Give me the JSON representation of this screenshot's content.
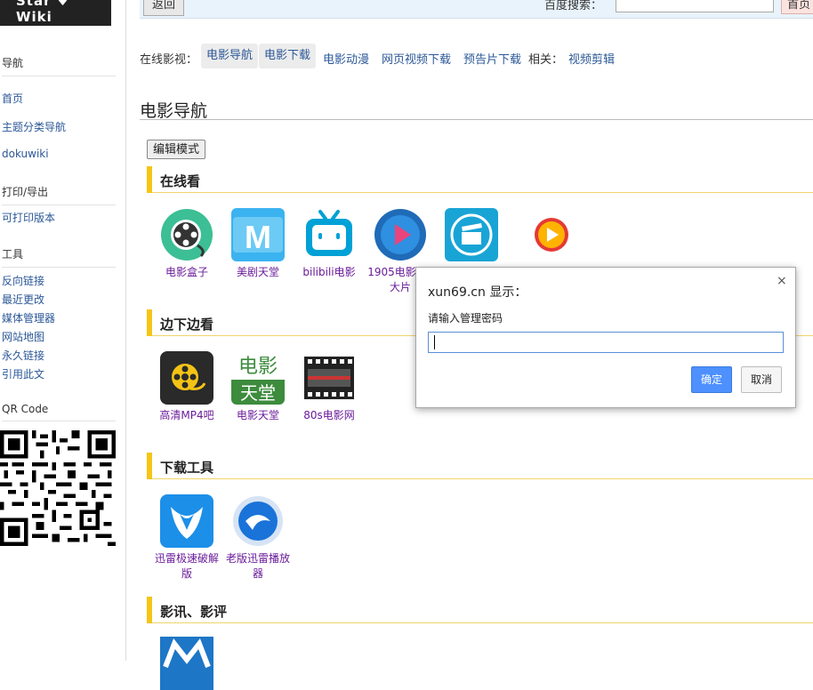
{
  "logo": {
    "text": "Star ♥ Wiki"
  },
  "sidebar": {
    "sections": [
      {
        "heading": "导航",
        "links": [
          "首页",
          "主题分类导航",
          "dokuwiki"
        ]
      },
      {
        "heading": "打印/导出",
        "links": [
          "可打印版本"
        ]
      },
      {
        "heading": "工具",
        "links": [
          "反向链接",
          "最近更改",
          "媒体管理器",
          "网站地图",
          "永久链接",
          "引用此文"
        ]
      },
      {
        "heading": "QR Code",
        "links": []
      }
    ]
  },
  "topbar": {
    "back_label": "返回",
    "search_label": "百度搜索：",
    "search_value": "",
    "home_label": "首页"
  },
  "nav": {
    "prefix": "在线影视：",
    "items": [
      "电影导航",
      "电影下载",
      "电影动漫",
      "网页视频下载",
      "预告片下载"
    ],
    "related_label": "相关：",
    "related_item": "视频剪辑"
  },
  "page": {
    "title": "电影导航",
    "edit_button": "编辑模式"
  },
  "sections": [
    {
      "heading": "在线看",
      "tiles": [
        {
          "caption": "电影盒子",
          "icon": "film-reel-icon"
        },
        {
          "caption": "美剧天堂",
          "icon": "meiju-icon"
        },
        {
          "caption": "bilibili电影",
          "icon": "bilibili-tv-icon"
        },
        {
          "caption": "1905电影网•大片",
          "icon": "play-circle-icon"
        },
        {
          "caption": "",
          "icon": "clapperboard-icon"
        },
        {
          "caption": "",
          "icon": "orange-play-icon"
        }
      ]
    },
    {
      "heading": "边下边看",
      "tiles": [
        {
          "caption": "高清MP4吧",
          "icon": "film-reel-dark-icon"
        },
        {
          "caption": "电影天堂",
          "icon": "dianying-tiantang-icon"
        },
        {
          "caption": "80s电影网",
          "icon": "film-strip-icon"
        }
      ]
    },
    {
      "heading": "下载工具",
      "tiles": [
        {
          "caption": "迅雷极速破解版",
          "icon": "thunder-bird-icon"
        },
        {
          "caption": "老版迅雷播放器",
          "icon": "thunder-player-icon"
        }
      ]
    },
    {
      "heading": "影讯、影评",
      "tiles": [
        {
          "caption": "",
          "icon": "mtime-icon"
        }
      ]
    }
  ],
  "dialog": {
    "title": "xun69.cn 显示：",
    "message": "请输入管理密码",
    "input_value": "",
    "ok_label": "确定",
    "cancel_label": "取消",
    "close_glyph": "×"
  },
  "colors": {
    "link": "#2b5797",
    "caption": "#6a1b9a",
    "section_bar": "#f5c518",
    "ok_button": "#4d90fe"
  }
}
